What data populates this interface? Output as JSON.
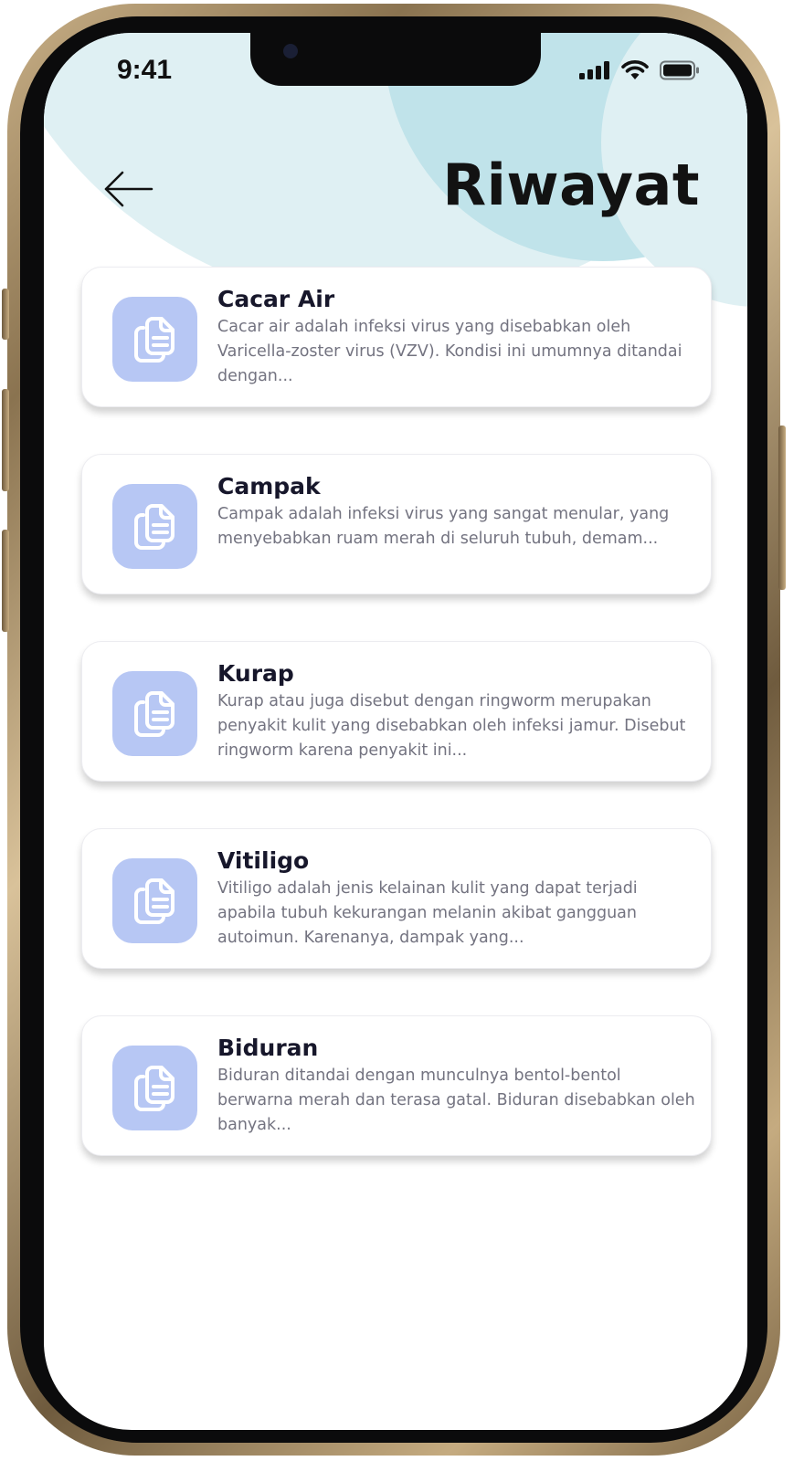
{
  "status_bar": {
    "time": "9:41",
    "icons": [
      "signal-icon",
      "wifi-icon",
      "battery-icon"
    ]
  },
  "header": {
    "back_icon": "arrow-left-icon",
    "title": "Riwayat"
  },
  "items": [
    {
      "title": "Cacar Air",
      "description": "Cacar air adalah infeksi virus yang disebabkan oleh Varicella-zoster virus (VZV). Kondisi ini umumnya ditandai dengan...",
      "icon": "document-copy-icon"
    },
    {
      "title": "Campak",
      "description": "Campak adalah infeksi virus yang sangat menular, yang menyebabkan ruam merah di seluruh tubuh, demam...",
      "icon": "document-copy-icon"
    },
    {
      "title": "Kurap",
      "description": "Kurap atau juga disebut dengan ringworm merupakan penyakit kulit yang disebabkan oleh infeksi jamur. Disebut ringworm karena penyakit ini...",
      "icon": "document-copy-icon"
    },
    {
      "title": "Vitiligo",
      "description": "Vitiligo adalah jenis kelainan kulit yang dapat terjadi apabila tubuh kekurangan melanin akibat gangguan autoimun. Karenanya, dampak yang...",
      "icon": "document-copy-icon"
    },
    {
      "title": "Biduran",
      "description": "Biduran ditandai dengan munculnya bentol-bentol berwarna merah dan terasa gatal. Biduran disebabkan oleh banyak...",
      "icon": "document-copy-icon"
    }
  ],
  "colors": {
    "header_bg": "#dff0f3",
    "header_circle": "#c0e3ea",
    "icon_tile": "#b7c7f4",
    "title_text": "#17172b",
    "desc_text": "#737380"
  }
}
